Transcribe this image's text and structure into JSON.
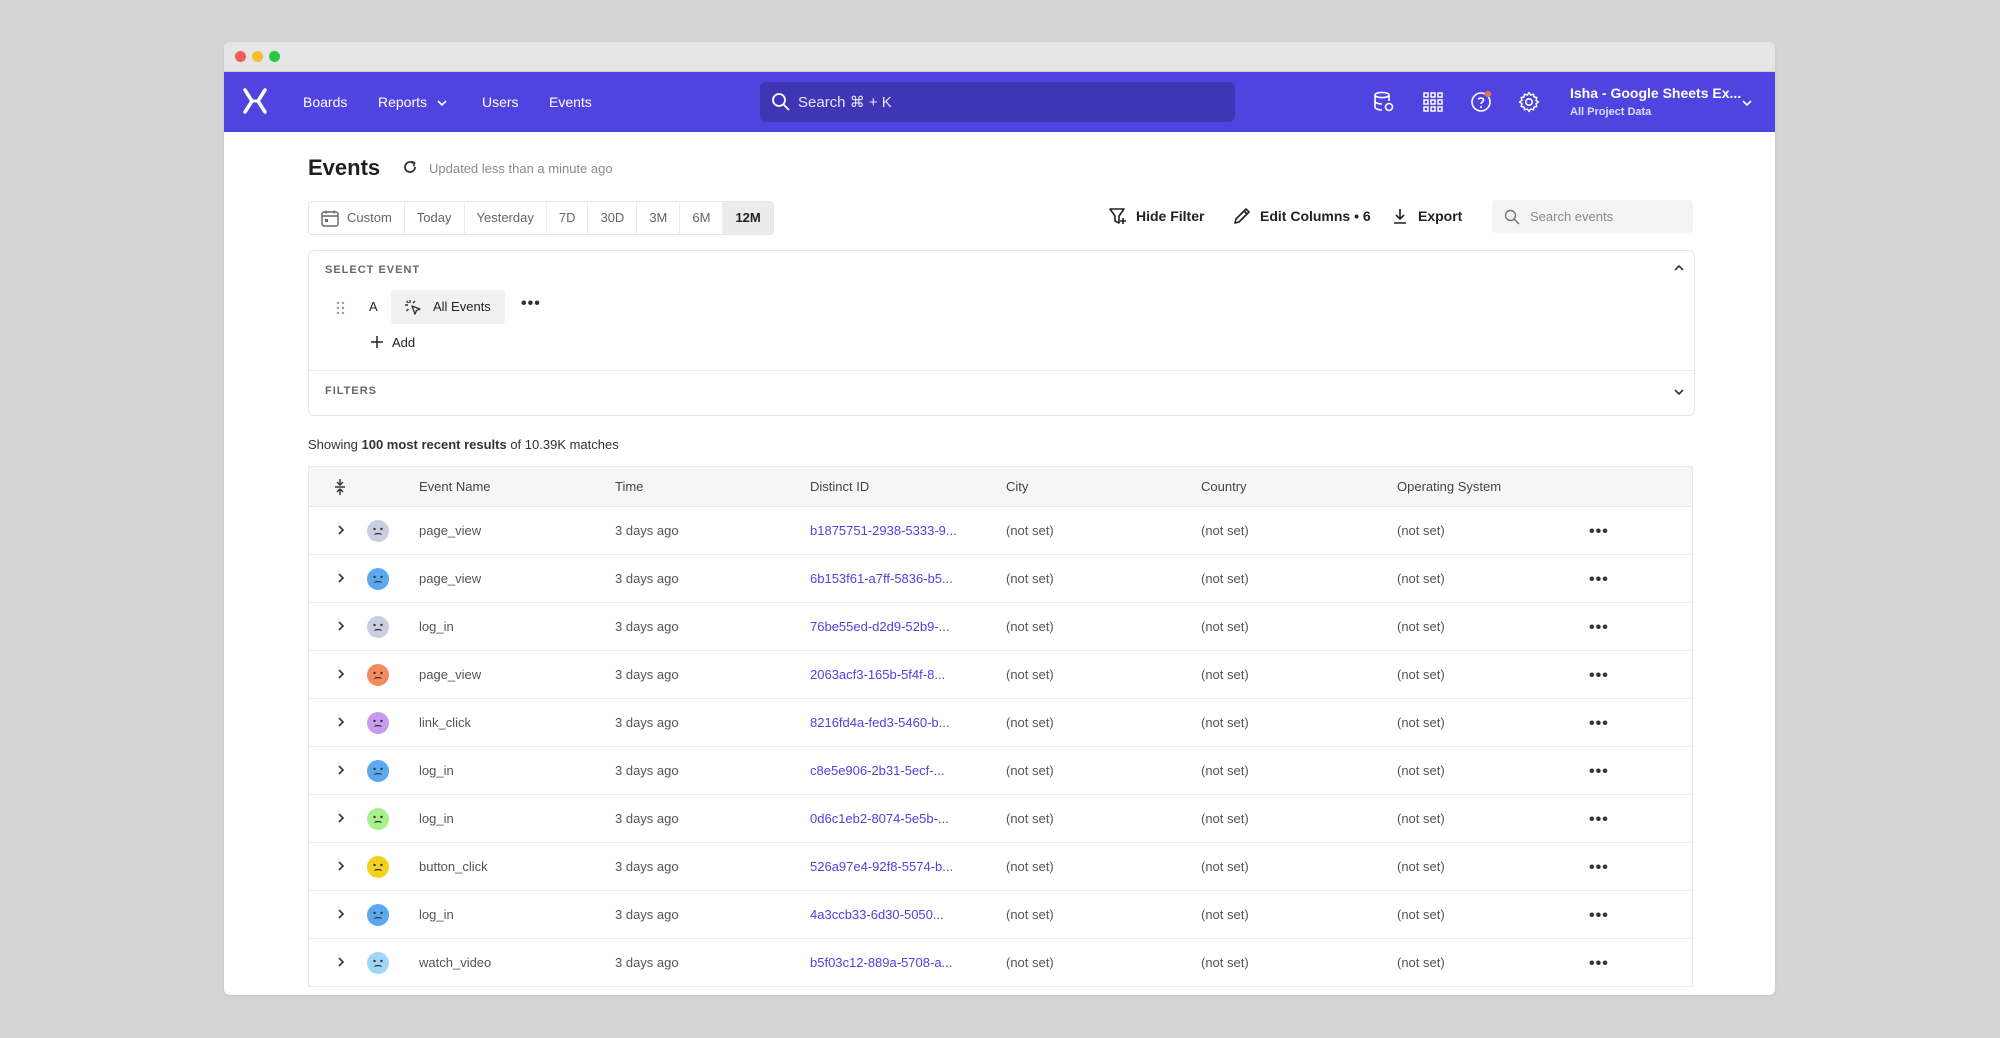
{
  "nav": {
    "items": [
      "Boards",
      "Reports",
      "Users",
      "Events"
    ],
    "search_placeholder": "Search ⌘ + K",
    "account_name": "Isha - Google Sheets Ex...",
    "account_sub": "All Project Data"
  },
  "page": {
    "title": "Events",
    "updated": "Updated less than a minute ago"
  },
  "date_range": {
    "options": [
      "Custom",
      "Today",
      "Yesterday",
      "7D",
      "30D",
      "3M",
      "6M",
      "12M"
    ],
    "selected": "12M"
  },
  "toolbar": {
    "hide_filter": "Hide Filter",
    "edit_columns": "Edit Columns • 6",
    "export": "Export",
    "search_placeholder": "Search events"
  },
  "select_event": {
    "label": "SELECT EVENT",
    "letter": "A",
    "event": "All Events",
    "add_label": "Add"
  },
  "filters": {
    "label": "FILTERS"
  },
  "results": {
    "prefix": "Showing ",
    "bold": "100 most recent results",
    "suffix": " of 10.39K matches"
  },
  "table": {
    "columns": [
      "Event Name",
      "Time",
      "Distinct ID",
      "City",
      "Country",
      "Operating System"
    ],
    "rows": [
      {
        "avatar_color": "#c9cfe0",
        "event": "page_view",
        "time": "3 days ago",
        "id": "b1875751-2938-5333-9...",
        "city": "(not set)",
        "country": "(not set)",
        "os": "(not set)"
      },
      {
        "avatar_color": "#5ba8f0",
        "event": "page_view",
        "time": "3 days ago",
        "id": "6b153f61-a7ff-5836-b5...",
        "city": "(not set)",
        "country": "(not set)",
        "os": "(not set)"
      },
      {
        "avatar_color": "#c9cfe0",
        "event": "log_in",
        "time": "3 days ago",
        "id": "76be55ed-d2d9-52b9-...",
        "city": "(not set)",
        "country": "(not set)",
        "os": "(not set)"
      },
      {
        "avatar_color": "#f28a5c",
        "event": "page_view",
        "time": "3 days ago",
        "id": "2063acf3-165b-5f4f-8...",
        "city": "(not set)",
        "country": "(not set)",
        "os": "(not set)"
      },
      {
        "avatar_color": "#c89af0",
        "event": "link_click",
        "time": "3 days ago",
        "id": "8216fd4a-fed3-5460-b...",
        "city": "(not set)",
        "country": "(not set)",
        "os": "(not set)"
      },
      {
        "avatar_color": "#5ba8f0",
        "event": "log_in",
        "time": "3 days ago",
        "id": "c8e5e906-2b31-5ecf-...",
        "city": "(not set)",
        "country": "(not set)",
        "os": "(not set)"
      },
      {
        "avatar_color": "#a8f08c",
        "event": "log_in",
        "time": "3 days ago",
        "id": "0d6c1eb2-8074-5e5b-...",
        "city": "(not set)",
        "country": "(not set)",
        "os": "(not set)"
      },
      {
        "avatar_color": "#f2d21e",
        "event": "button_click",
        "time": "3 days ago",
        "id": "526a97e4-92f8-5574-b...",
        "city": "(not set)",
        "country": "(not set)",
        "os": "(not set)"
      },
      {
        "avatar_color": "#5ba8f0",
        "event": "log_in",
        "time": "3 days ago",
        "id": "4a3ccb33-6d30-5050...",
        "city": "(not set)",
        "country": "(not set)",
        "os": "(not set)"
      },
      {
        "avatar_color": "#9fd6f7",
        "event": "watch_video",
        "time": "3 days ago",
        "id": "b5f03c12-889a-5708-a...",
        "city": "(not set)",
        "country": "(not set)",
        "os": "(not set)"
      }
    ]
  },
  "colors": {
    "brand": "#4f44e0",
    "link": "#4f44e0"
  }
}
